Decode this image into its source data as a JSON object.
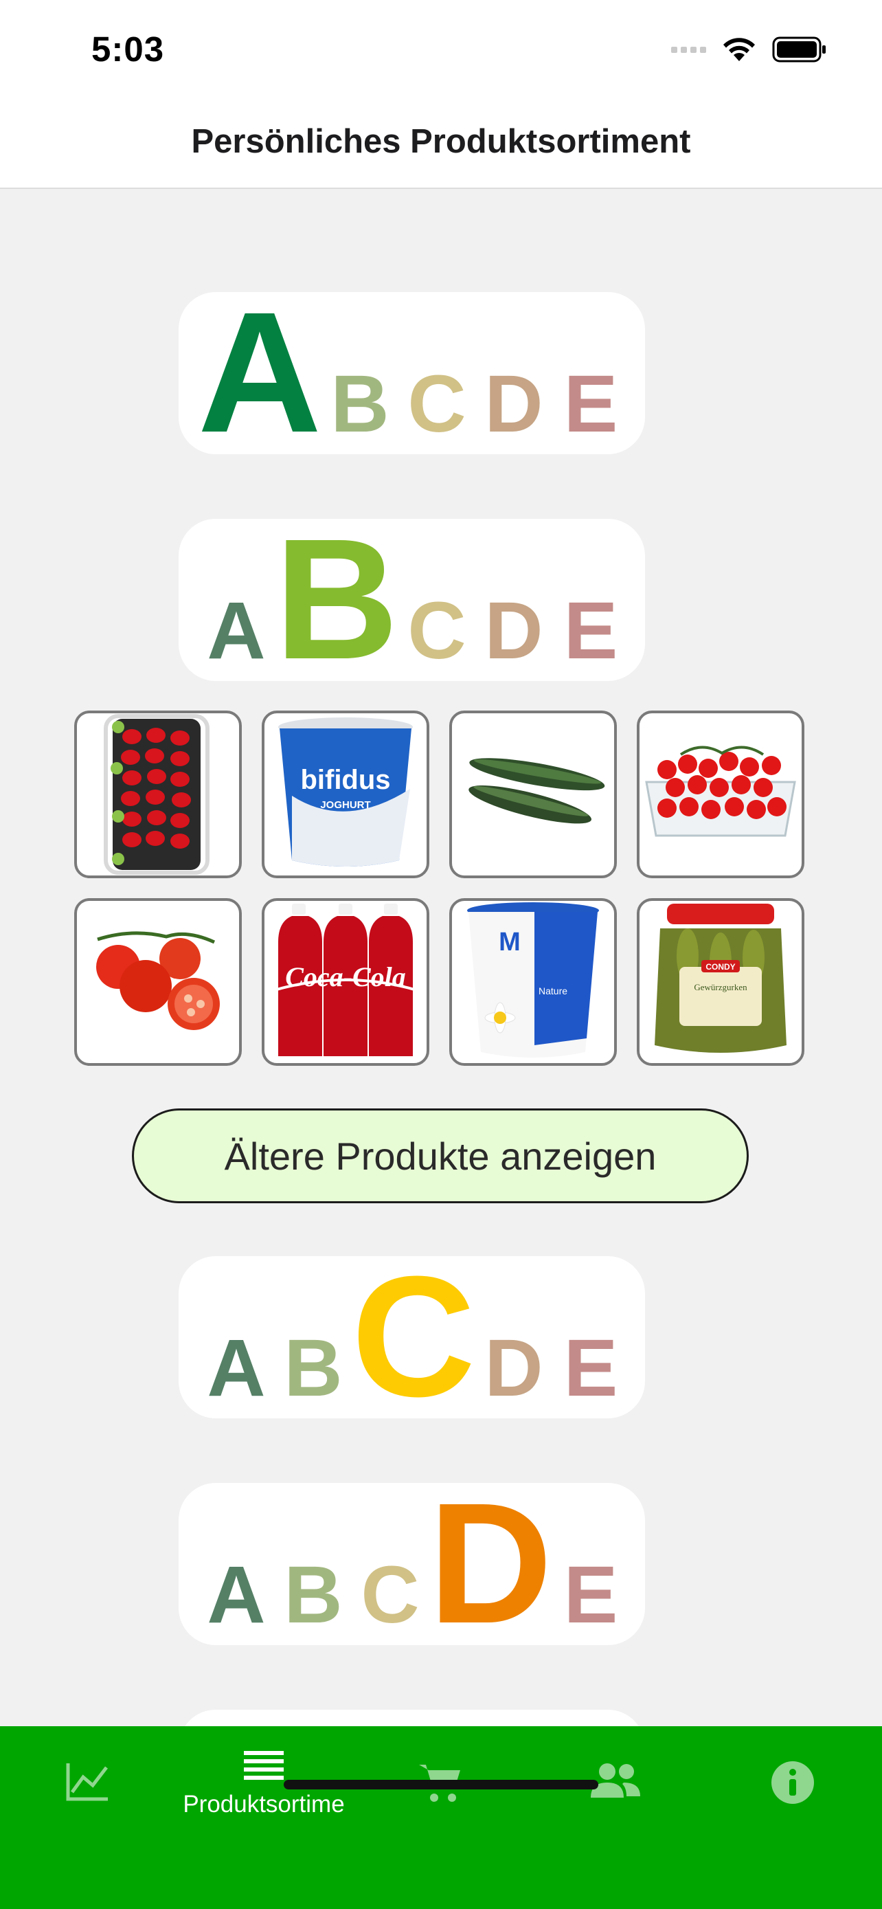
{
  "status_bar": {
    "time": "5:03"
  },
  "nav": {
    "title": "Persönliches Produktsortiment"
  },
  "scores": {
    "letters": [
      "A",
      "B",
      "C",
      "D",
      "E"
    ],
    "colors": {
      "A": "#038141",
      "B": "#85bb2f",
      "C": "#fecb02",
      "D": "#ee8100",
      "E": "#e63e11",
      "A_faded": "#4c7a5e",
      "B_faded": "#9db47a",
      "C_faded": "#cfbe80",
      "D_faded": "#c3a07f",
      "E_faded": "#c08583"
    },
    "cards": [
      {
        "highlight": "A"
      },
      {
        "highlight": "B"
      },
      {
        "highlight": "C"
      },
      {
        "highlight": "D"
      },
      {
        "highlight": "E"
      }
    ]
  },
  "products": [
    {
      "name": "Cherry tomatoes tray",
      "icon": "tomato-tray-icon"
    },
    {
      "name": "Bifidus yoghurt",
      "icon": "yoghurt-cup-icon",
      "text": "bifidus",
      "subtext": "JOGHURT"
    },
    {
      "name": "Cucumbers",
      "icon": "cucumber-icon"
    },
    {
      "name": "Cherry tomatoes basket",
      "icon": "tomato-basket-icon"
    },
    {
      "name": "Vine tomatoes",
      "icon": "tomato-icon"
    },
    {
      "name": "Coca-Cola 6-pack",
      "icon": "cola-bottles-icon",
      "text": "Coca-Cola"
    },
    {
      "name": "Nature yoghurt",
      "icon": "yoghurt-cup-icon",
      "text": "M",
      "subtext": "Nature"
    },
    {
      "name": "Pickles jar",
      "icon": "pickle-jar-icon",
      "text": "CONDY",
      "subtext": "Gewürzgurken"
    }
  ],
  "older_button": {
    "label": "Ältere Produkte anzeigen"
  },
  "tabs": [
    {
      "icon": "chart-line-icon",
      "label": ""
    },
    {
      "icon": "list-icon",
      "label": "Produktsortime",
      "active": true
    },
    {
      "icon": "cart-icon",
      "label": ""
    },
    {
      "icon": "people-icon",
      "label": ""
    },
    {
      "icon": "info-icon",
      "label": ""
    }
  ],
  "theme": {
    "tab_bar": "#00a600",
    "button_bg": "#e7fbd4",
    "background": "#f1f1f1"
  }
}
